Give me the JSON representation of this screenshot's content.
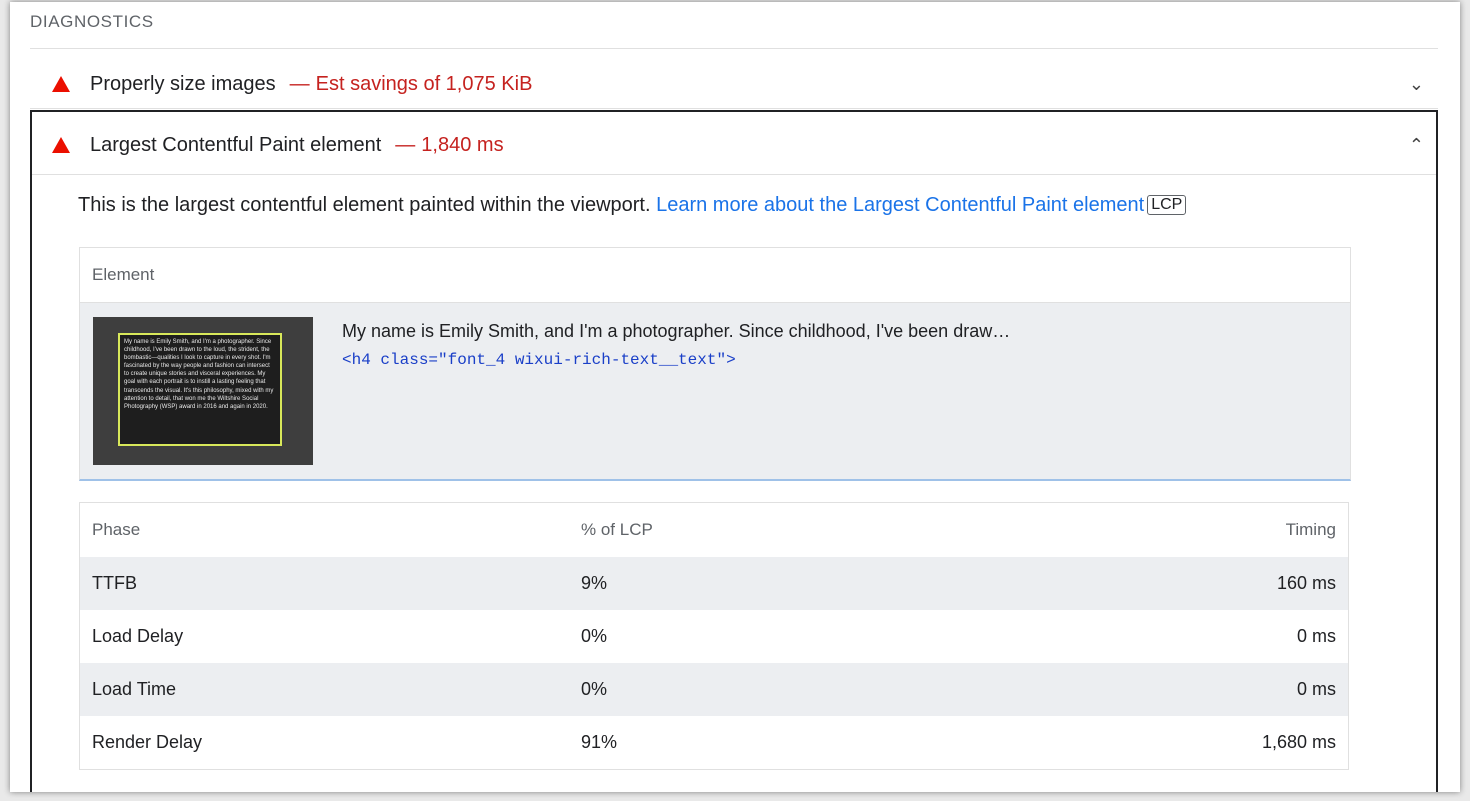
{
  "section": {
    "header": "DIAGNOSTICS"
  },
  "audits": [
    {
      "title": "Properly size images",
      "separator": "—",
      "detail": "Est savings of 1,075 KiB",
      "chevron": "⌄",
      "icon": "warning-triangle-icon",
      "expanded": false
    },
    {
      "title": "Largest Contentful Paint element",
      "separator": "—",
      "detail": "1,840 ms",
      "chevron": "⌃",
      "icon": "warning-triangle-icon",
      "expanded": true
    }
  ],
  "lcp": {
    "description": "This is the largest contentful element painted within the viewport.",
    "learn_more": "Learn more about the Largest Contentful Paint element",
    "badge": "LCP",
    "element_header": "Element",
    "element_snippet": "My name is Emily Smith, and I'm a photographer. Since childhood, I've been draw…",
    "element_code": "<h4 class=\"font_4 wixui-rich-text__text\">",
    "thumbnail_text": "My name is Emily Smith, and I'm a photographer. Since childhood, I've been drawn to the loud, the strident, the bombastic—qualities I look to capture in every shot. I'm fascinated by the way people and fashion can intersect to create unique stories and visceral experiences. My goal with each portrait is to instill a lasting feeling that transcends the visual. It's this philosophy, mixed with my attention to detail, that won me the Wiltshire Social Photography (WSP) award in 2016 and again in 2020.",
    "phase_headers": [
      "Phase",
      "% of LCP",
      "Timing"
    ],
    "phases": [
      {
        "phase": "TTFB",
        "pct": "9%",
        "timing": "160 ms"
      },
      {
        "phase": "Load Delay",
        "pct": "0%",
        "timing": "0 ms"
      },
      {
        "phase": "Load Time",
        "pct": "0%",
        "timing": "0 ms"
      },
      {
        "phase": "Render Delay",
        "pct": "91%",
        "timing": "1,680 ms"
      }
    ]
  },
  "colors": {
    "warning": "#eb0f00",
    "link": "#1a73e8",
    "code": "#1a3fc8",
    "thumbnail_highlight": "#d8e85a"
  }
}
